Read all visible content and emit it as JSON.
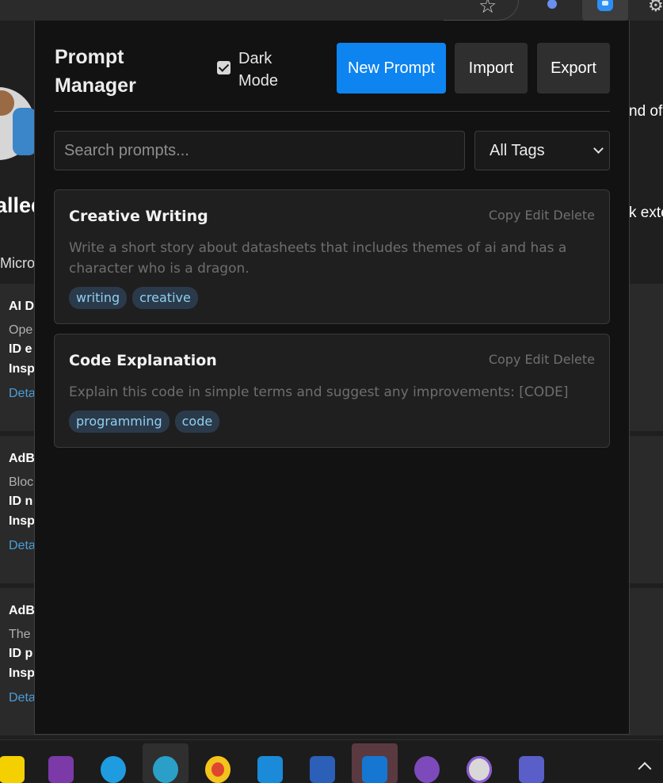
{
  "popup": {
    "title": "Prompt Manager",
    "dark_mode_label": "Dark Mode",
    "dark_mode_checked": true,
    "buttons": {
      "new_prompt": "New Prompt",
      "import": "Import",
      "export": "Export"
    },
    "search": {
      "placeholder": "Search prompts...",
      "value": ""
    },
    "tag_filter": {
      "selected": "All Tags"
    },
    "prompts": [
      {
        "title": "Creative Writing",
        "actions": [
          "Copy",
          "Edit",
          "Delete"
        ],
        "body": "Write a short story about datasheets that includes themes of ai and has a character who is a dragon.",
        "tags": [
          "writing",
          "creative"
        ]
      },
      {
        "title": "Code Explanation",
        "actions": [
          "Copy",
          "Edit",
          "Delete"
        ],
        "body": "Explain this code in simple terms and suggest any improvements: [CODE]",
        "tags": [
          "programming",
          "code"
        ]
      }
    ]
  },
  "background": {
    "heading_fragment": "alled",
    "subheading_fragment": "Micro",
    "right_fragments": [
      "nd of",
      "k exte"
    ],
    "cards": [
      {
        "title": "AI D",
        "desc": "Ope",
        "id": "ID e",
        "insp": "Insp",
        "link": "Deta"
      },
      {
        "title": "AdB",
        "desc": "Bloc",
        "id": "ID n",
        "insp": "Insp",
        "link": "Deta"
      },
      {
        "title": "AdB",
        "desc": "The",
        "id": "ID p",
        "insp": "Insp",
        "link": "Deta"
      }
    ]
  },
  "colors": {
    "accent": "#0d84f0",
    "popup_bg": "#121212",
    "card_bg": "#1f1f1f",
    "tag_bg": "#2b3a4b",
    "tag_text": "#8fd0f0"
  },
  "browser": {
    "icons": [
      "star-icon",
      "extension-icon",
      "prompt-manager-icon",
      "settings-icon"
    ]
  },
  "taskbar": {
    "apps": [
      "sticky-notes",
      "onenote",
      "edge",
      "edge-dev",
      "chrome",
      "vscode",
      "word",
      "outlook",
      "github-desktop",
      "media-player",
      "teams"
    ]
  }
}
